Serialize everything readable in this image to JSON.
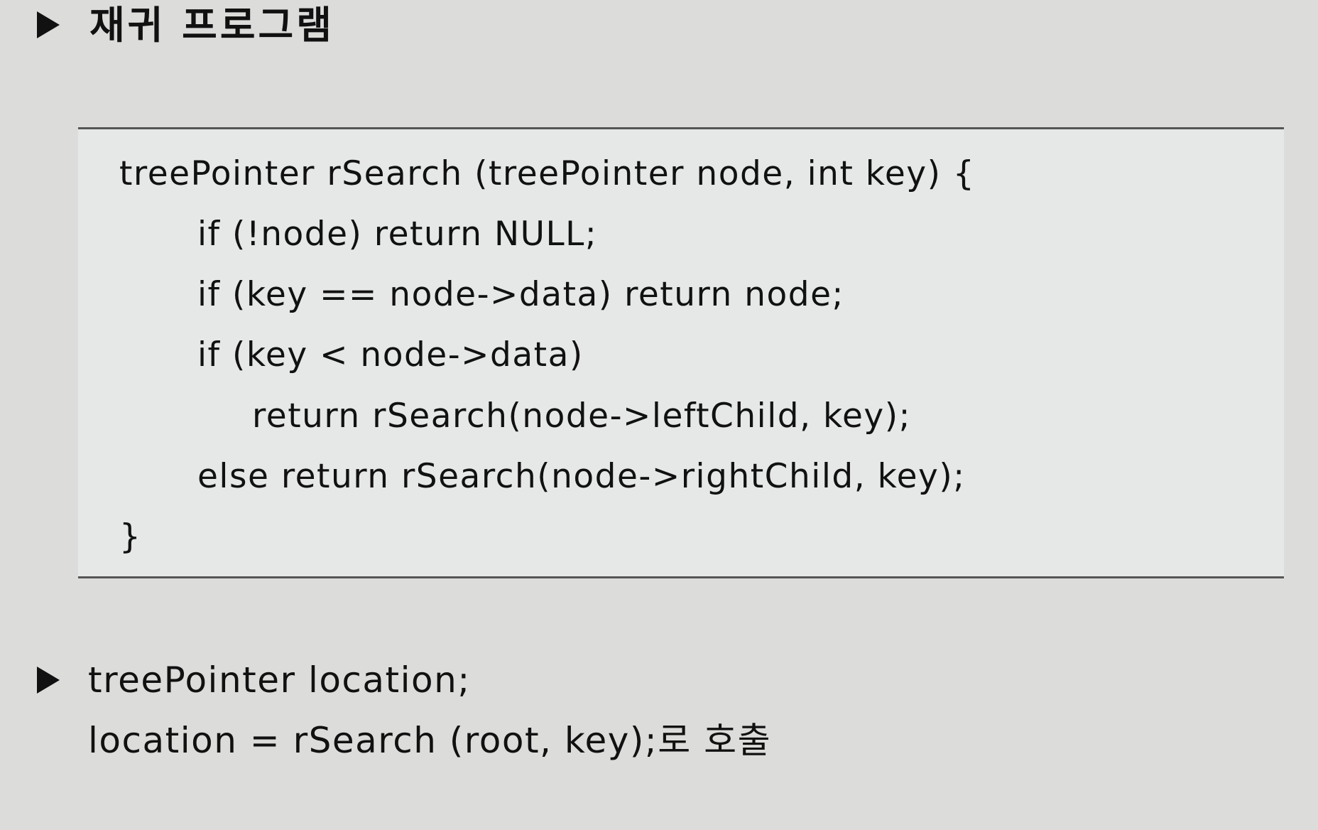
{
  "slide": {
    "heading": "재귀 프로그램",
    "code_lines": [
      "treePointer rSearch (treePointer node, int key) {",
      "if (!node) return NULL;",
      "if (key == node->data) return node;",
      "if (key < node->data)",
      "return rSearch(node->leftChild, key);",
      "else return rSearch(node->rightChild, key);",
      "}"
    ],
    "note_line1": "treePointer location;",
    "note_line2": "location = rSearch (root, key);로 호출"
  }
}
